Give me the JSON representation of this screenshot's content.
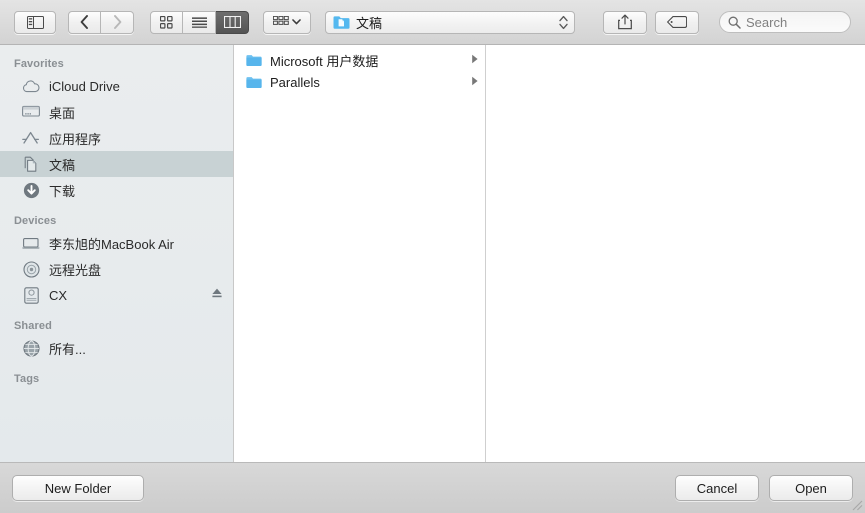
{
  "toolbar": {
    "sidebar_toggle": "sidebar-toggle",
    "back": "back",
    "forward": "forward",
    "view_modes": [
      {
        "name": "icon-view",
        "label": "Icon View",
        "active": false
      },
      {
        "name": "list-view",
        "label": "List View",
        "active": false
      },
      {
        "name": "column-view",
        "label": "Column View",
        "active": true
      }
    ],
    "arrange_label": "Arrange",
    "path": {
      "label": "文稿",
      "icon": "blue-document-folder-icon"
    },
    "share_label": "Share",
    "tag_label": "Tags",
    "search": {
      "placeholder": "Search",
      "value": ""
    }
  },
  "sidebar": {
    "sections": [
      {
        "header": "Favorites",
        "items": [
          {
            "label": "iCloud Drive",
            "icon": "cloud-icon",
            "selected": false,
            "eject": false
          },
          {
            "label": "桌面",
            "icon": "desktop-icon",
            "selected": false,
            "eject": false
          },
          {
            "label": "应用程序",
            "icon": "applications-icon",
            "selected": false,
            "eject": false
          },
          {
            "label": "文稿",
            "icon": "documents-icon",
            "selected": true,
            "eject": false
          },
          {
            "label": "下载",
            "icon": "downloads-icon",
            "selected": false,
            "eject": false
          }
        ]
      },
      {
        "header": "Devices",
        "items": [
          {
            "label": "李东旭的MacBook Air",
            "icon": "laptop-icon",
            "selected": false,
            "eject": false
          },
          {
            "label": "远程光盘",
            "icon": "disc-icon",
            "selected": false,
            "eject": false
          },
          {
            "label": "CX",
            "icon": "external-drive-icon",
            "selected": false,
            "eject": true
          }
        ]
      },
      {
        "header": "Shared",
        "items": [
          {
            "label": "所有...",
            "icon": "globe-icon",
            "selected": false,
            "eject": false
          }
        ]
      },
      {
        "header": "Tags",
        "items": []
      }
    ]
  },
  "columns": [
    {
      "rows": [
        {
          "name": "Microsoft 用户数据",
          "icon": "folder-icon",
          "has_children": true,
          "selected": false
        },
        {
          "name": "Parallels",
          "icon": "folder-icon",
          "has_children": true,
          "selected": false
        }
      ]
    }
  ],
  "bottom_bar": {
    "new_folder_label": "New Folder",
    "cancel_label": "Cancel",
    "open_label": "Open"
  },
  "colors": {
    "folder_blue": "#54b8ef",
    "selection_gray": "#c8d2d4",
    "toolbar_gray": "#dcdcdc",
    "bottom_gray": "#d2d2d2"
  }
}
